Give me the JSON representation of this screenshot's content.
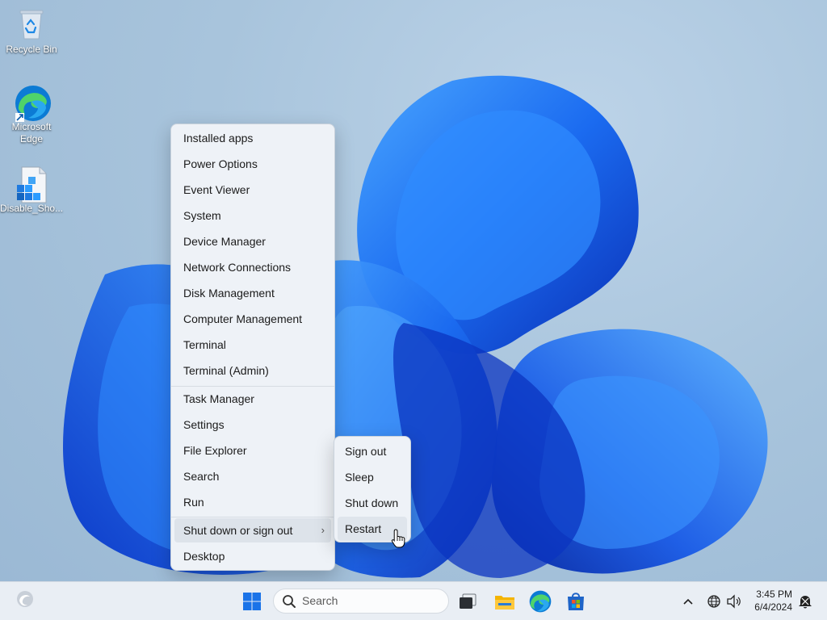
{
  "desktop": {
    "icons": [
      {
        "label": "Recycle Bin",
        "icon": "recycle-bin-icon"
      },
      {
        "label": "Microsoft Edge",
        "icon": "edge-icon"
      },
      {
        "label": "Disable_Sho...",
        "icon": "registry-file-icon"
      }
    ]
  },
  "context_menu": {
    "items": [
      {
        "label": "Installed apps"
      },
      {
        "label": "Power Options"
      },
      {
        "label": "Event Viewer"
      },
      {
        "label": "System"
      },
      {
        "label": "Device Manager"
      },
      {
        "label": "Network Connections"
      },
      {
        "label": "Disk Management"
      },
      {
        "label": "Computer Management"
      },
      {
        "label": "Terminal"
      },
      {
        "label": "Terminal (Admin)"
      },
      {
        "label": "Task Manager"
      },
      {
        "label": "Settings"
      },
      {
        "label": "File Explorer"
      },
      {
        "label": "Search"
      },
      {
        "label": "Run"
      },
      {
        "label": "Shut down or sign out",
        "submenu": true,
        "active": true
      },
      {
        "label": "Desktop"
      }
    ],
    "chevron": "›"
  },
  "submenu": {
    "items": [
      {
        "label": "Sign out"
      },
      {
        "label": "Sleep"
      },
      {
        "label": "Shut down"
      },
      {
        "label": "Restart",
        "hovered": true
      }
    ]
  },
  "taskbar": {
    "search_placeholder": "Search",
    "apps": [
      "start-icon",
      "task-view-icon",
      "file-explorer-icon",
      "edge-icon",
      "store-icon"
    ],
    "tray": {
      "time": "3:45 PM",
      "date": "6/4/2024"
    }
  },
  "colors": {
    "accent": "#0f6cbd",
    "menu_bg": "#eef2f7"
  }
}
